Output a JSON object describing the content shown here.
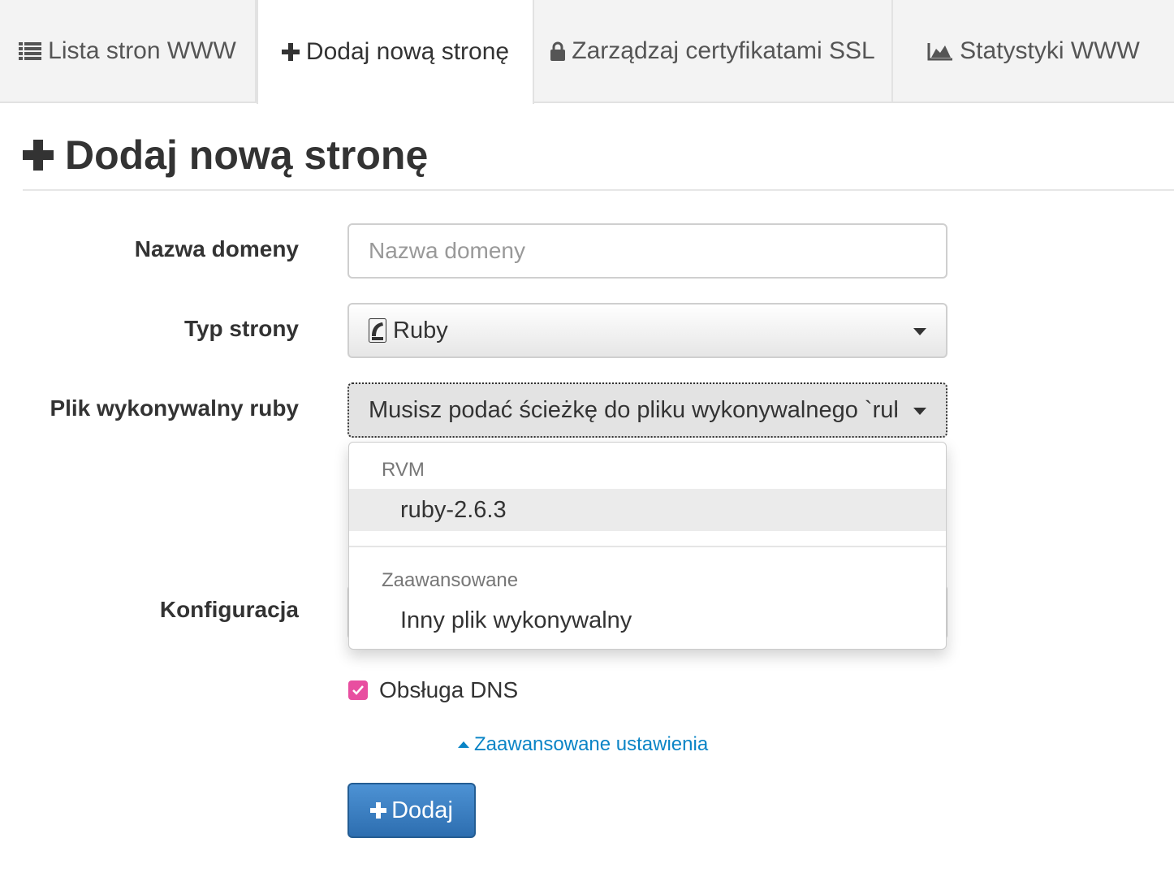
{
  "tabs": [
    {
      "label": "Lista stron WWW",
      "icon": "list-icon",
      "active": false
    },
    {
      "label": "Dodaj nową stronę",
      "icon": "plus-icon",
      "active": true
    },
    {
      "label": "Zarządzaj certyfikatami SSL",
      "icon": "lock-icon",
      "active": false
    },
    {
      "label": "Statystyki WWW",
      "icon": "area-chart-icon",
      "active": false
    }
  ],
  "page": {
    "title": "Dodaj nową stronę",
    "title_icon": "plus-icon"
  },
  "form": {
    "domain": {
      "label": "Nazwa domeny",
      "placeholder": "Nazwa domeny",
      "value": ""
    },
    "site_type": {
      "label": "Typ strony",
      "value": "Ruby",
      "icon": "rails-icon"
    },
    "ruby_exec": {
      "label": "Plik wykonywalny ruby",
      "value": "Musisz podać ścieżkę do pliku wykonywalnego `ruby`"
    },
    "config": {
      "label": "Konfiguracja"
    },
    "dns": {
      "label": "Obsługa DNS",
      "checked": true
    },
    "advanced_link": "Zaawansowane ustawienia",
    "submit_label": "Dodaj"
  },
  "dropdown": {
    "groups": [
      {
        "header": "RVM",
        "items": [
          "ruby-2.6.3"
        ]
      },
      {
        "header": "Zaawansowane",
        "items": [
          "Inny plik wykonywalny"
        ]
      }
    ]
  },
  "colors": {
    "accent_blue": "#2d6eb0",
    "link_blue": "#0a84c6",
    "checkbox_pink": "#e84ea0"
  }
}
